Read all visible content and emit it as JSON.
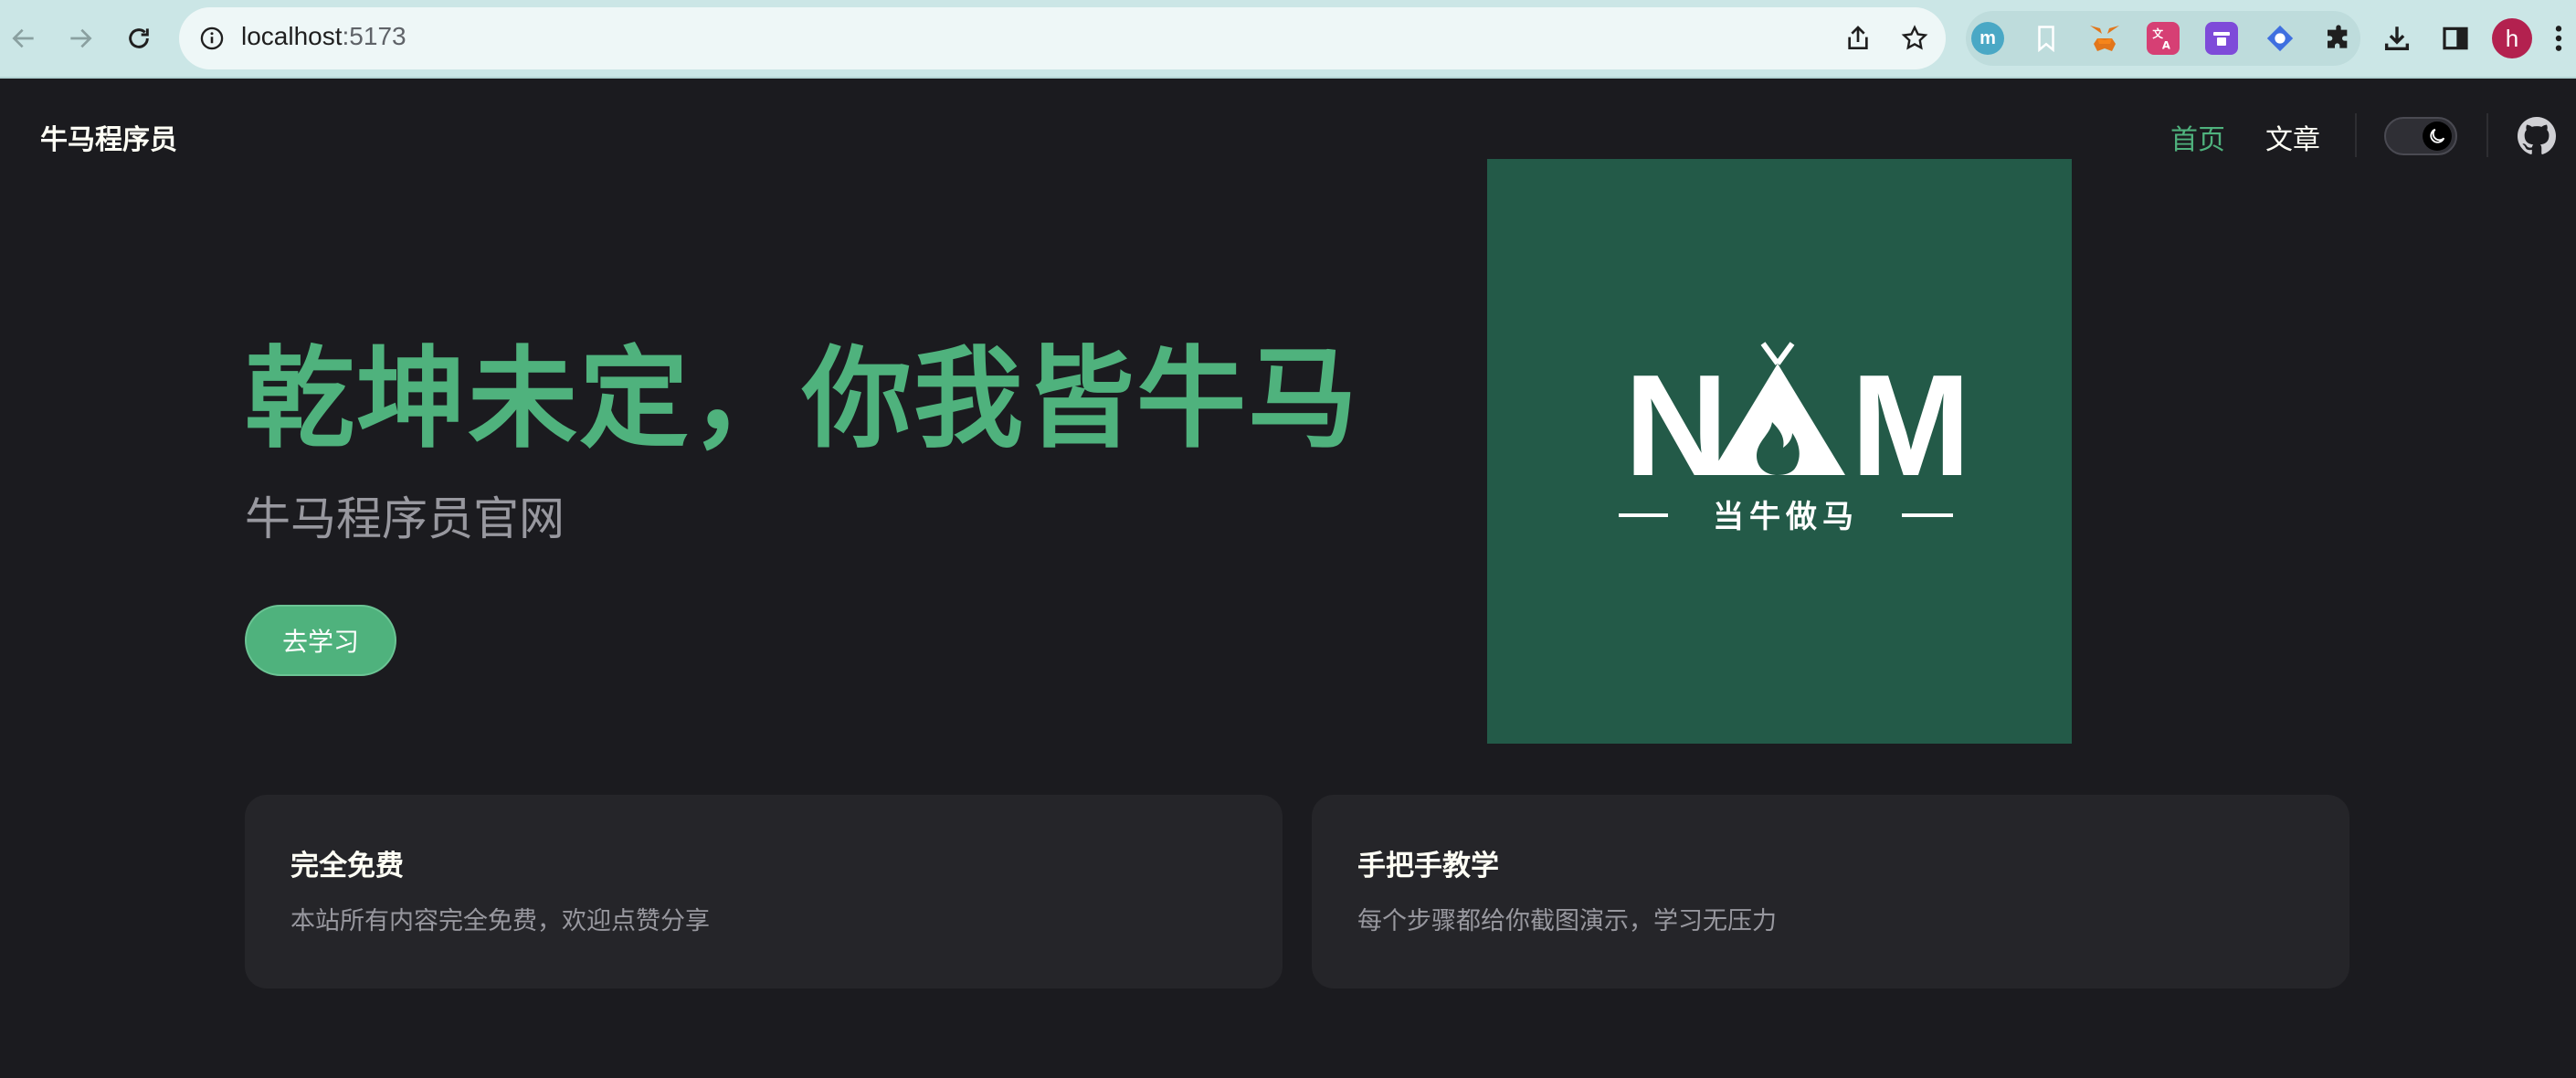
{
  "browser": {
    "url_host": "localhost",
    "url_port": ":5173",
    "extensions": [
      {
        "icon": "m-circle-extension-icon",
        "letter": "m",
        "color": "#4aa8c5"
      },
      {
        "icon": "bookmark-extension-icon",
        "color": "#ffffff"
      },
      {
        "icon": "metamask-fox-icon",
        "color": "#e2761b"
      },
      {
        "icon": "translate-extension-icon",
        "color": "#d63f74"
      },
      {
        "icon": "purple-extension-icon",
        "color": "#7e4bd9"
      },
      {
        "icon": "blue-diamond-extension-icon",
        "color": "#3f6fe0"
      }
    ],
    "avatar_letter": "h",
    "avatar_color": "#b3214f"
  },
  "nav": {
    "site_title": "牛马程序员",
    "links": [
      {
        "label": "首页",
        "active": true
      },
      {
        "label": "文章",
        "active": false
      }
    ]
  },
  "hero": {
    "title": "乾坤未定，你我皆牛马",
    "subtitle": "牛马程序员官网",
    "button_label": "去学习",
    "logo_text_n": "N",
    "logo_text_m": "M",
    "logo_tagline": "当牛做马"
  },
  "features": [
    {
      "title": "完全免费",
      "desc": "本站所有内容完全免费，欢迎点赞分享"
    },
    {
      "title": "手把手教学",
      "desc": "每个步骤都给你截图演示，学习无压力"
    }
  ],
  "colors": {
    "brand": "#4fb27d",
    "background": "#1b1b1f",
    "card": "#252529",
    "logo_bg": "#235a48"
  }
}
